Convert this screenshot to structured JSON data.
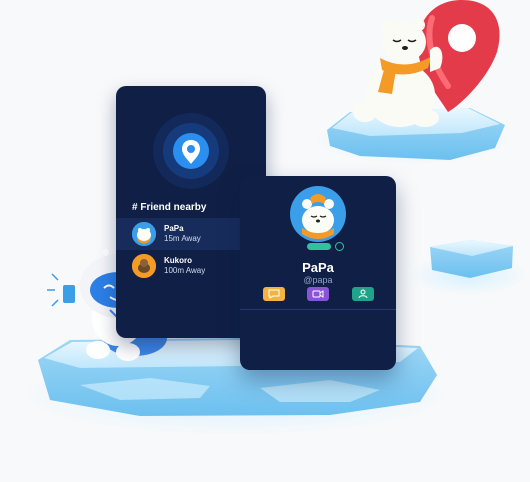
{
  "nearby": {
    "title": "# Friend nearby",
    "friends": [
      {
        "name": "PaPa",
        "distance": "15m Away"
      },
      {
        "name": "Kukoro",
        "distance": "100m Away"
      }
    ]
  },
  "profile": {
    "status_badge": "",
    "name": "PaPa",
    "handle": "@papa"
  },
  "actions": {
    "chat_icon": "chat-bubble-icon",
    "video_icon": "video-camera-icon",
    "person_icon": "person-icon"
  },
  "colors": {
    "card_bg": "#0f1f45",
    "accent_blue": "#3a9ee9",
    "chat_btn": "#f2b340",
    "video_btn": "#8a54d8",
    "person_btn": "#1fa38a",
    "ice": "#cfeefe",
    "pin_red": "#e43b4a"
  }
}
